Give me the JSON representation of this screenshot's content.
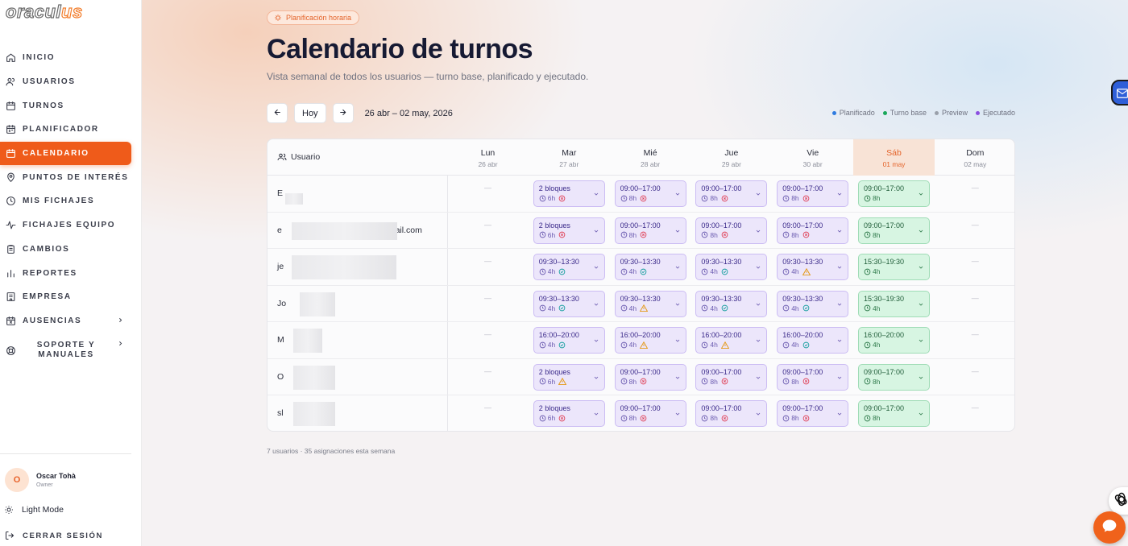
{
  "brand": {
    "logo_main": "oracul",
    "logo_accent": "us"
  },
  "sidebar": {
    "items": [
      {
        "label": "INICIO",
        "icon": "home-icon"
      },
      {
        "label": "USUARIOS",
        "icon": "users-icon"
      },
      {
        "label": "TURNOS",
        "icon": "calendar-icon"
      },
      {
        "label": "PLANIFICADOR",
        "icon": "calendar-grid-icon"
      },
      {
        "label": "CALENDARIO",
        "icon": "calendar-icon",
        "active": true
      },
      {
        "label": "PUNTOS DE INTERÉS",
        "icon": "map-pin-icon"
      },
      {
        "label": "MIS FICHAJES",
        "icon": "clock-icon"
      },
      {
        "label": "FICHAJES EQUIPO",
        "icon": "activity-icon"
      },
      {
        "label": "CAMBIOS",
        "icon": "clipboard-icon"
      },
      {
        "label": "REPORTES",
        "icon": "bar-chart-icon"
      },
      {
        "label": "EMPRESA",
        "icon": "building-icon"
      },
      {
        "label": "AUSENCIAS",
        "icon": "calendar-x-icon",
        "expandable": true
      },
      {
        "label": "SOPORTE Y MANUALES",
        "icon": "life-buoy-icon",
        "expandable": true
      }
    ],
    "user": {
      "initial": "O",
      "name": "Oscar Tohà",
      "role": "Owner"
    },
    "light_mode": "Light Mode",
    "logout": "CERRAR SESIÓN"
  },
  "page": {
    "badge": "Planificación horaria",
    "title": "Calendario de turnos",
    "subtitle": "Vista semanal de todos los usuarios — turno base, planificado y ejecutado.",
    "today_button": "Hoy",
    "date_range": "26 abr – 02 may, 2026",
    "legend": [
      {
        "label": "Planificado",
        "color": "#2f7be0"
      },
      {
        "label": "Turno base",
        "color": "#1aa85a"
      },
      {
        "label": "Preview",
        "color": "#9aa0aa"
      },
      {
        "label": "Ejecutado",
        "color": "#8b4fe0"
      }
    ],
    "footer": "7 usuarios · 35 asignaciones esta semana"
  },
  "table": {
    "user_header": "Usuario",
    "days": [
      {
        "name": "Lun",
        "date": "26 abr"
      },
      {
        "name": "Mar",
        "date": "27 abr"
      },
      {
        "name": "Mié",
        "date": "28 abr"
      },
      {
        "name": "Jue",
        "date": "29 abr"
      },
      {
        "name": "Vie",
        "date": "30 abr"
      },
      {
        "name": "Sáb",
        "date": "01 may",
        "today": true
      },
      {
        "name": "Dom",
        "date": "02 may"
      }
    ],
    "empty": "—",
    "rows": [
      {
        "user": "E",
        "cells": [
          null,
          {
            "time": "2 bloques",
            "hours": "6h",
            "status": "x",
            "type": "planned"
          },
          {
            "time": "09:00–17:00",
            "hours": "8h",
            "status": "x",
            "type": "planned"
          },
          {
            "time": "09:00–17:00",
            "hours": "8h",
            "status": "x",
            "type": "planned"
          },
          {
            "time": "09:00–17:00",
            "hours": "8h",
            "status": "x",
            "type": "planned"
          },
          {
            "time": "09:00–17:00",
            "hours": "8h",
            "status": "none",
            "type": "base"
          },
          null
        ]
      },
      {
        "user": "e",
        "user_suffix": "mail.com",
        "cells": [
          null,
          {
            "time": "2 bloques",
            "hours": "6h",
            "status": "x",
            "type": "planned"
          },
          {
            "time": "09:00–17:00",
            "hours": "8h",
            "status": "x",
            "type": "planned"
          },
          {
            "time": "09:00–17:00",
            "hours": "8h",
            "status": "x",
            "type": "planned"
          },
          {
            "time": "09:00–17:00",
            "hours": "8h",
            "status": "x",
            "type": "planned"
          },
          {
            "time": "09:00–17:00",
            "hours": "8h",
            "status": "none",
            "type": "base"
          },
          null
        ]
      },
      {
        "user": "je",
        "cells": [
          null,
          {
            "time": "09:30–13:30",
            "hours": "4h",
            "status": "ok",
            "type": "planned"
          },
          {
            "time": "09:30–13:30",
            "hours": "4h",
            "status": "ok",
            "type": "planned"
          },
          {
            "time": "09:30–13:30",
            "hours": "4h",
            "status": "ok",
            "type": "planned"
          },
          {
            "time": "09:30–13:30",
            "hours": "4h",
            "status": "warn",
            "type": "planned"
          },
          {
            "time": "15:30–19:30",
            "hours": "4h",
            "status": "none",
            "type": "base"
          },
          null
        ]
      },
      {
        "user": "Jo",
        "cells": [
          null,
          {
            "time": "09:30–13:30",
            "hours": "4h",
            "status": "ok",
            "type": "planned"
          },
          {
            "time": "09:30–13:30",
            "hours": "4h",
            "status": "warn",
            "type": "planned"
          },
          {
            "time": "09:30–13:30",
            "hours": "4h",
            "status": "ok",
            "type": "planned"
          },
          {
            "time": "09:30–13:30",
            "hours": "4h",
            "status": "ok",
            "type": "planned"
          },
          {
            "time": "15:30–19:30",
            "hours": "4h",
            "status": "none",
            "type": "base"
          },
          null
        ]
      },
      {
        "user": "M",
        "cells": [
          null,
          {
            "time": "16:00–20:00",
            "hours": "4h",
            "status": "ok",
            "type": "planned"
          },
          {
            "time": "16:00–20:00",
            "hours": "4h",
            "status": "warn",
            "type": "planned"
          },
          {
            "time": "16:00–20:00",
            "hours": "4h",
            "status": "warn",
            "type": "planned"
          },
          {
            "time": "16:00–20:00",
            "hours": "4h",
            "status": "ok",
            "type": "planned"
          },
          {
            "time": "16:00–20:00",
            "hours": "4h",
            "status": "none",
            "type": "base"
          },
          null
        ]
      },
      {
        "user": "O",
        "cells": [
          null,
          {
            "time": "2 bloques",
            "hours": "6h",
            "status": "warn",
            "type": "planned"
          },
          {
            "time": "09:00–17:00",
            "hours": "8h",
            "status": "x",
            "type": "planned"
          },
          {
            "time": "09:00–17:00",
            "hours": "8h",
            "status": "x",
            "type": "planned"
          },
          {
            "time": "09:00–17:00",
            "hours": "8h",
            "status": "x",
            "type": "planned"
          },
          {
            "time": "09:00–17:00",
            "hours": "8h",
            "status": "none",
            "type": "base"
          },
          null
        ]
      },
      {
        "user": "sl",
        "cells": [
          null,
          {
            "time": "2 bloques",
            "hours": "6h",
            "status": "x",
            "type": "planned"
          },
          {
            "time": "09:00–17:00",
            "hours": "8h",
            "status": "x",
            "type": "planned"
          },
          {
            "time": "09:00–17:00",
            "hours": "8h",
            "status": "x",
            "type": "planned"
          },
          {
            "time": "09:00–17:00",
            "hours": "8h",
            "status": "x",
            "type": "planned"
          },
          {
            "time": "09:00–17:00",
            "hours": "8h",
            "status": "none",
            "type": "base"
          },
          null
        ]
      }
    ]
  }
}
